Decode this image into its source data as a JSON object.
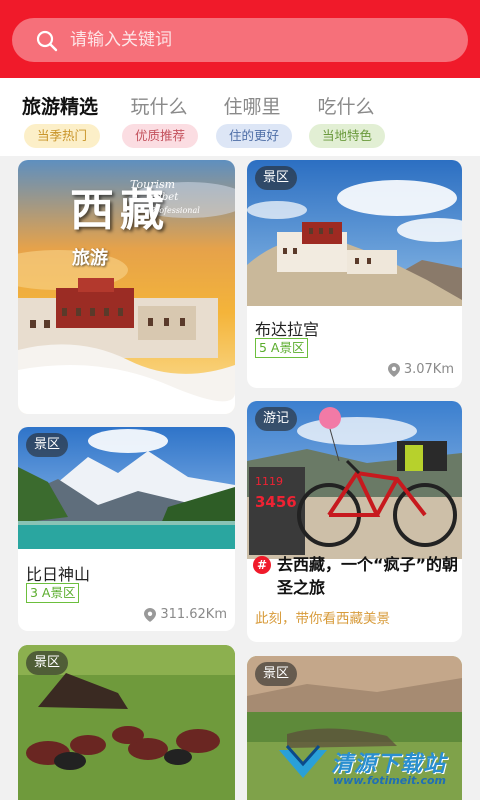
{
  "search": {
    "placeholder": "请输入关键词"
  },
  "tabs": [
    {
      "label": "旅游精选",
      "active": true
    },
    {
      "label": "玩什么",
      "active": false
    },
    {
      "label": "住哪里",
      "active": false
    },
    {
      "label": "吃什么",
      "active": false
    }
  ],
  "pills": [
    {
      "label": "当季热门",
      "bg": "#fcefc8",
      "color": "#c9952a"
    },
    {
      "label": "优质推荐",
      "bg": "#fbdde2",
      "color": "#c4535e"
    },
    {
      "label": "住的更好",
      "bg": "#dde6f6",
      "color": "#4f6fa7"
    },
    {
      "label": "当地特色",
      "bg": "#e2efd4",
      "color": "#6a9a3c"
    }
  ],
  "cards": {
    "promo": {
      "title_big": "西藏",
      "title_small": "旅游",
      "en_line1": "Tourism",
      "en_line2": "Tibet",
      "en_line3": "Professional"
    },
    "potala": {
      "tag": "景区",
      "name": "布达拉宫",
      "level": "5 A景区",
      "distance": "3.07Km"
    },
    "bipeak": {
      "tag": "景区",
      "name": "比日神山",
      "level": "3 A景区",
      "distance": "311.62Km"
    },
    "travelog": {
      "tag": "游记",
      "title": "去西藏，一个“疯子”的朝圣之旅",
      "subtitle": "此刻，带你看西藏美景",
      "badge": "#",
      "sign_text": "3456"
    },
    "nomad": {
      "tag": "景区"
    },
    "plain": {
      "tag": "景区"
    }
  },
  "watermark": {
    "text": "清源下载站",
    "url": "www.fotimeit.com"
  }
}
